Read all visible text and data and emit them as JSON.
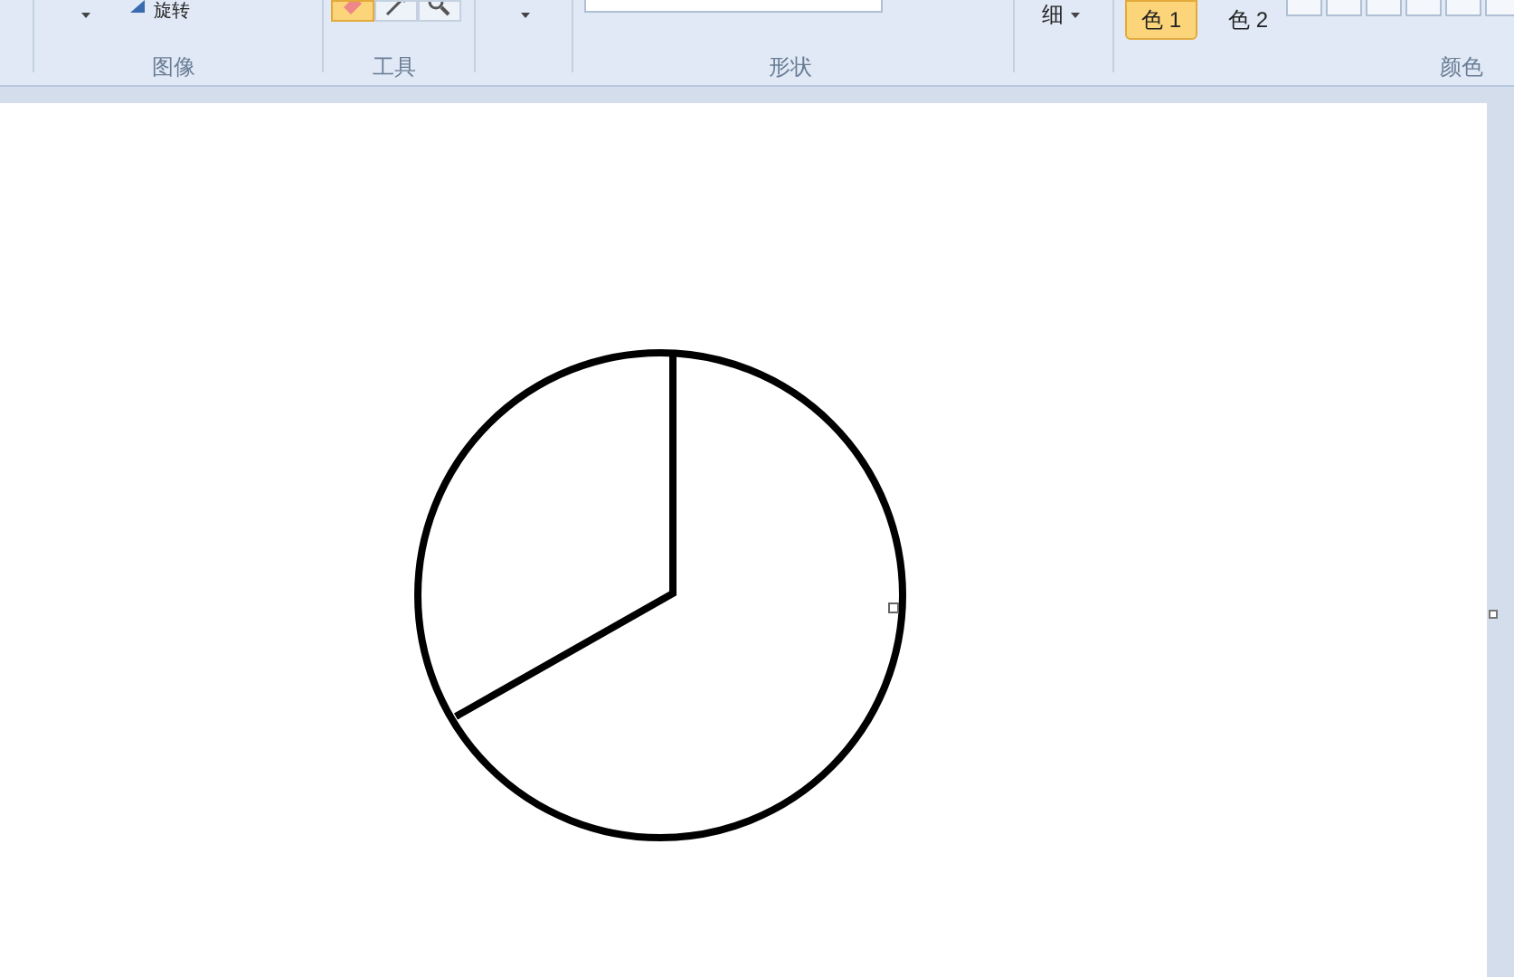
{
  "ribbon": {
    "image_group": {
      "label": "图像",
      "rotate_label": "旋转"
    },
    "tools_group": {
      "label": "工具",
      "tools": [
        {
          "kind": "eraser",
          "selected": true
        },
        {
          "kind": "picker",
          "selected": false
        },
        {
          "kind": "magnifier",
          "selected": false
        }
      ]
    },
    "shapes_group": {
      "label": "形状"
    },
    "size_label": "细",
    "colors_group": {
      "label": "颜色",
      "colors": [
        {
          "label": "色 1",
          "selected": true
        },
        {
          "label": "色 2",
          "selected": false
        }
      ]
    }
  }
}
